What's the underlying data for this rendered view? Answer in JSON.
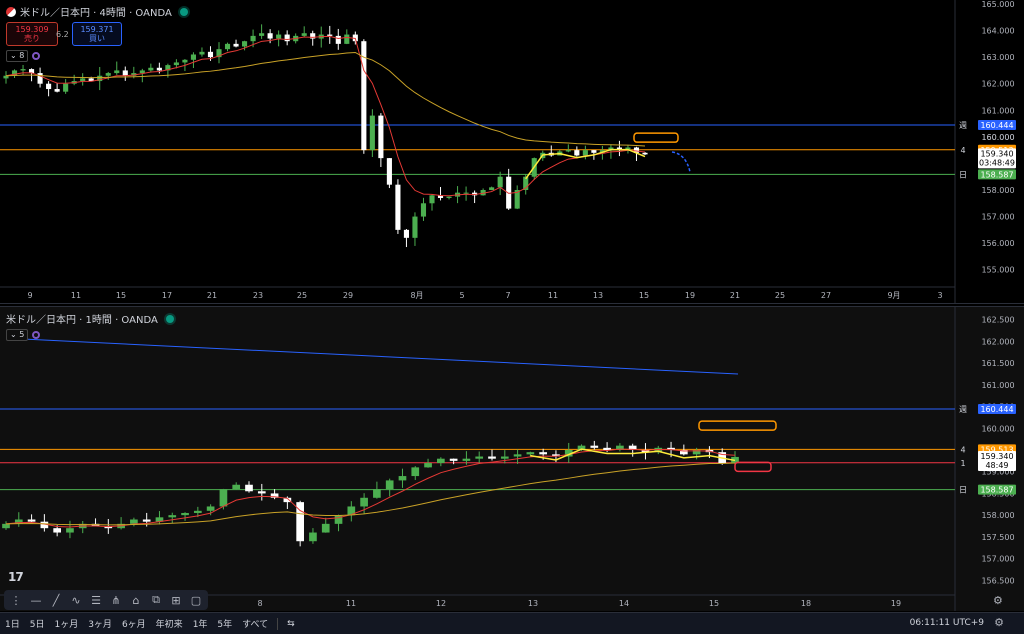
{
  "top": {
    "title": "米ドル／日本円 · 4時間 · OANDA",
    "sell_price": "159.309",
    "sell_label": "売り",
    "buy_price": "159.371",
    "buy_label": "買い",
    "spread": "6.2",
    "indicator_count": "8"
  },
  "bottom": {
    "title": "米ドル／日本円 · 1時間 · OANDA",
    "indicator_count": "5"
  },
  "colors": {
    "up": "#26a69a",
    "up_bright": "#4caf50",
    "down": "#ffffff",
    "weekly": "#2962ff",
    "level4": "#ff9800",
    "daily": "#4caf50",
    "ma_red": "#e53935",
    "ma_yellow": "#c9a227",
    "zigzag": "#ffeb3b",
    "level1": "#f23645"
  },
  "timeframes": [
    "1日",
    "5日",
    "1ヶ月",
    "3ヶ月",
    "6ヶ月",
    "年初来",
    "1年",
    "5年",
    "すべて"
  ],
  "clock": "06:11:11 UTC+9",
  "icons": [
    "trend-line-icon",
    "ray-icon",
    "brush-icon",
    "fib-icon",
    "pitchfork-icon",
    "pattern-icon",
    "projection-icon",
    "grid-icon",
    "rect-icon"
  ],
  "chart_data": [
    {
      "type": "candlestick",
      "title": "米ドル／日本円 · 4時間 · OANDA",
      "ylim": [
        154.5,
        165.0
      ],
      "y_ticks": [
        "165.000",
        "164.000",
        "163.000",
        "162.000",
        "161.000",
        "160.000",
        "159.000",
        "158.000",
        "157.000",
        "156.000",
        "155.000"
      ],
      "x_ticks": [
        "9",
        "11",
        "15",
        "17",
        "21",
        "23",
        "25",
        "29",
        "8月",
        "5",
        "7",
        "11",
        "13",
        "15",
        "19",
        "21",
        "25",
        "27",
        "9月",
        "3"
      ],
      "close_path": [
        162.3,
        162.5,
        162.55,
        162.4,
        162.0,
        161.8,
        161.7,
        162.0,
        162.1,
        162.2,
        162.1,
        162.3,
        162.4,
        162.5,
        162.3,
        162.4,
        162.5,
        162.6,
        162.5,
        162.7,
        162.8,
        162.9,
        163.1,
        163.2,
        163.0,
        163.3,
        163.5,
        163.4,
        163.6,
        163.8,
        163.9,
        163.7,
        163.85,
        163.6,
        163.8,
        163.9,
        163.7,
        163.85,
        163.8,
        163.5,
        163.85,
        163.6,
        159.5,
        160.8,
        159.2,
        158.2,
        156.5,
        156.2,
        157.0,
        157.5,
        157.8,
        157.7,
        157.75,
        157.9,
        157.9,
        157.8,
        158.0,
        158.1,
        158.5,
        157.3,
        158.0,
        158.5,
        159.2,
        159.4,
        159.3,
        159.45,
        159.5,
        159.3,
        159.5,
        159.4,
        159.5,
        159.6,
        159.5,
        159.6,
        159.4,
        159.34
      ],
      "levels": [
        {
          "label": "週",
          "value": 160.444
        },
        {
          "label": "4",
          "value": 159.513
        },
        {
          "label": "日",
          "value": 158.587
        }
      ],
      "last_price": "159.340",
      "countdown": "03:48:49",
      "tick_160": "160.000"
    },
    {
      "type": "candlestick",
      "title": "米ドル／日本円 · 1時間 · OANDA",
      "ylim": [
        156.3,
        162.7
      ],
      "y_ticks": [
        "162.500",
        "162.000",
        "161.500",
        "161.000",
        "160.500",
        "160.000",
        "159.500",
        "159.000",
        "158.500",
        "158.000",
        "157.500",
        "157.000",
        "156.500"
      ],
      "x_ticks": [
        "8",
        "11",
        "12",
        "13",
        "14",
        "15",
        "18",
        "19"
      ],
      "close_path": [
        157.8,
        157.9,
        157.85,
        157.7,
        157.6,
        157.7,
        157.8,
        157.75,
        157.7,
        157.8,
        157.9,
        157.85,
        157.95,
        158.0,
        158.05,
        158.1,
        158.2,
        158.6,
        158.7,
        158.55,
        158.5,
        158.4,
        158.3,
        157.4,
        157.6,
        157.8,
        158.0,
        158.2,
        158.4,
        158.6,
        158.8,
        158.9,
        159.1,
        159.2,
        159.3,
        159.25,
        159.3,
        159.35,
        159.3,
        159.35,
        159.4,
        159.45,
        159.4,
        159.35,
        159.5,
        159.6,
        159.55,
        159.5,
        159.6,
        159.5,
        159.45,
        159.55,
        159.5,
        159.4,
        159.5,
        159.45,
        159.2,
        159.34
      ],
      "levels": [
        {
          "label": "週",
          "value": 160.444
        },
        {
          "label": "4",
          "value": 159.513
        },
        {
          "label": "1",
          "value": 159.206
        },
        {
          "label": "日",
          "value": 158.587
        }
      ],
      "last_price": "159.340",
      "countdown": "48:49"
    }
  ]
}
